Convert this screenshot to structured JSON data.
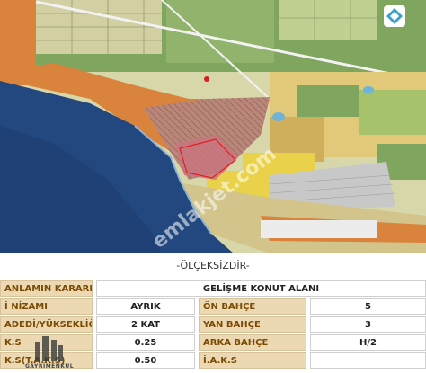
{
  "map": {
    "watermark": "emlakjet.com",
    "colors": {
      "sea": "#23477f",
      "land_green": "#6f9c52",
      "land_light": "#d8d7a9",
      "orange_zone": "#d9833d",
      "pink_zone": "#c8757f",
      "yellow_zone": "#e9d24a",
      "hatched_zone": "#b87b6f",
      "gray_zone": "#c8c8c8",
      "road": "#f2f2f2"
    },
    "icons": [
      "compass-icon"
    ]
  },
  "scale_note": "-ÖLÇEKSİZDİR-",
  "table": {
    "header_label": "ANLAMIN KARARI",
    "header_value": "GELİŞME KONUT ALANI",
    "rows": [
      {
        "left_label": "İ NİZAMI",
        "left_value": "AYRIK",
        "right_label": "ÖN BAHÇE",
        "right_value": "5"
      },
      {
        "left_label": "ADEDİ/YÜKSEKLİĞİ",
        "left_value": "2 KAT",
        "right_label": "YAN BAHÇE",
        "right_value": "3"
      },
      {
        "left_label": "K.S",
        "left_value": "0.25",
        "right_label": "ARKA BAHÇE",
        "right_value": "H/2"
      },
      {
        "left_label": "K.S(T.A.K.S)",
        "left_value": "0.50",
        "right_label": "İ.A.K.S",
        "right_value": ""
      }
    ]
  },
  "logo": {
    "text": "GAYRİMENKUL"
  }
}
